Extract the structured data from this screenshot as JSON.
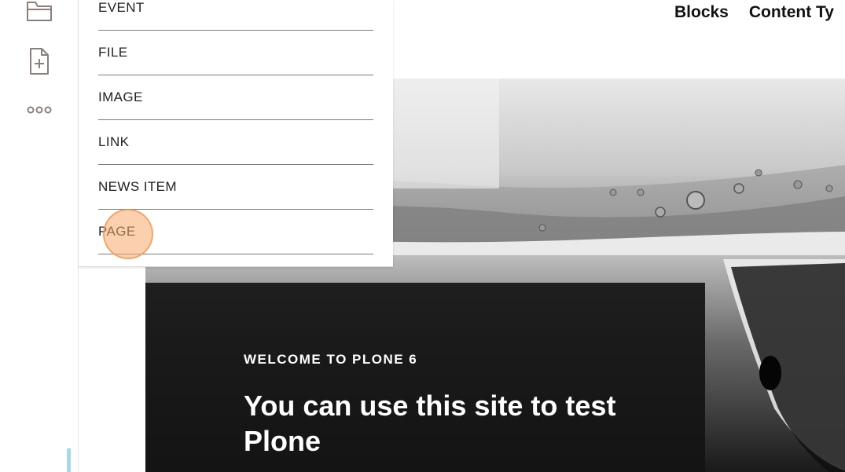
{
  "toolbar": {
    "items": [
      {
        "name": "folder-icon"
      },
      {
        "name": "add-document-icon"
      },
      {
        "name": "more-icon"
      }
    ],
    "icon_color": "#8a7f7a",
    "accent_color": "#a8d8e6"
  },
  "topnav": {
    "items": [
      "Blocks",
      "Content Ty"
    ]
  },
  "add_menu": {
    "items": [
      "EVENT",
      "FILE",
      "IMAGE",
      "LINK",
      "NEWS ITEM",
      "PAGE"
    ],
    "highlighted": "PAGE"
  },
  "hero": {
    "kicker": "WELCOME TO PLONE 6",
    "title": "You can use this site to test Plone"
  },
  "click_marker_color": "#f8aa6e"
}
